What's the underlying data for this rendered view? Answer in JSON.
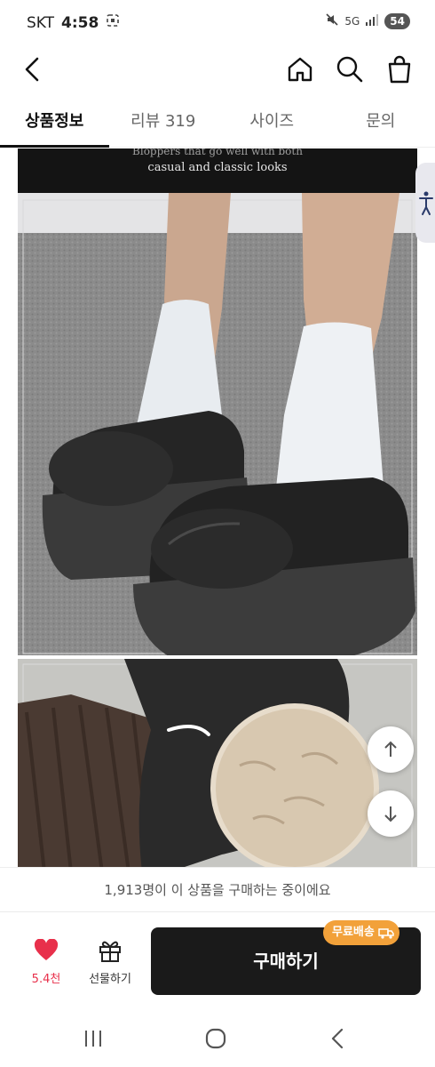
{
  "status_bar": {
    "carrier": "SKT",
    "time": "4:58",
    "network": "5G",
    "battery": "54"
  },
  "nav": {
    "back_icon": "chevron-left-icon",
    "home_icon": "home-icon",
    "search_icon": "search-icon",
    "cart_icon": "shopping-bag-icon"
  },
  "tabs": [
    {
      "label": "상품정보",
      "active": true
    },
    {
      "label": "리뷰 319",
      "active": false
    },
    {
      "label": "사이즈",
      "active": false
    },
    {
      "label": "문의",
      "active": false
    }
  ],
  "banner": {
    "line1": "Bloppers that go well with both",
    "line2": "casual and classic looks"
  },
  "buyers_text": "1,913명이 이 상품을 구매하는 중이에요",
  "purchase": {
    "like_count": "5.4천",
    "gift_label": "선물하기",
    "buy_label": "구매하기",
    "free_shipping_label": "무료배송"
  },
  "colors": {
    "accent_like": "#e8304b",
    "buy_button": "#1a1a1a",
    "free_ship_badge": "#f2a13a"
  }
}
